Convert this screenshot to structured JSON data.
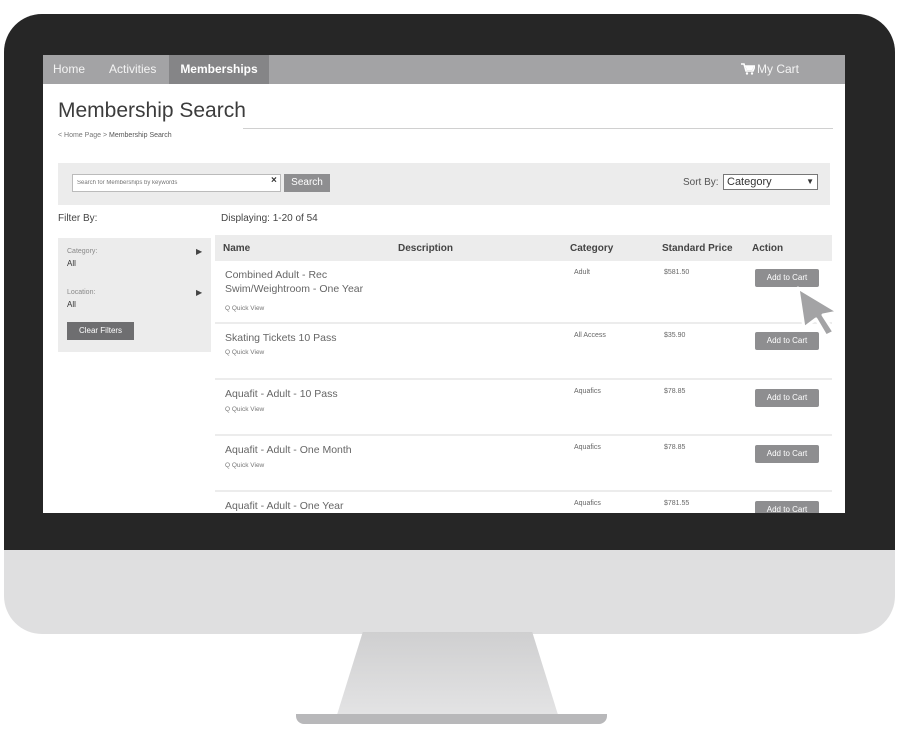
{
  "colors": {
    "nav_bg": "#a3a3a5",
    "nav_active_bg": "#858587",
    "button_bg": "#8e8e90",
    "bezel": "#262626",
    "monitor_body": "#dfdfe0",
    "panel_bg": "#ececec"
  },
  "nav": {
    "items": [
      {
        "label": "Home"
      },
      {
        "label": "Activities"
      },
      {
        "label": "Memberships",
        "active": true
      }
    ],
    "cart_label": "My Cart",
    "cart_icon": "shopping-cart-icon"
  },
  "page": {
    "title": "Membership Search",
    "breadcrumb": {
      "home": "< Home Page >",
      "current": "Membership Search"
    }
  },
  "search": {
    "placeholder": "Search for Memberships by keywords",
    "clear_label": "×",
    "button_label": "Search",
    "sort_label": "Sort By:",
    "sort_value": "Category"
  },
  "filters": {
    "title": "Filter By:",
    "groups": [
      {
        "label": "Category:",
        "value": "All"
      },
      {
        "label": "Location:",
        "value": "All"
      }
    ],
    "clear_label": "Clear Filters"
  },
  "results": {
    "displaying": "Displaying: 1-20 of 54",
    "columns": [
      "Name",
      "Description",
      "Category",
      "Standard Price",
      "Action"
    ],
    "add_label": "Add to Cart",
    "quick_view_label": "Q Quick View",
    "rows": [
      {
        "name": "Combined Adult - Rec Swim/Weightroom - One Year",
        "category": "Adult",
        "price": "$581.50"
      },
      {
        "name": "Skating Tickets 10 Pass",
        "category": "All Access",
        "price": "$35.90"
      },
      {
        "name": "Aquafit - Adult - 10 Pass",
        "category": "Aquafics",
        "price": "$78.85"
      },
      {
        "name": "Aquafit - Adult - One Month",
        "category": "Aquafics",
        "price": "$78.85"
      },
      {
        "name": "Aquafit - Adult - One Year",
        "category": "Aquafics",
        "price": "$781.55"
      }
    ]
  }
}
